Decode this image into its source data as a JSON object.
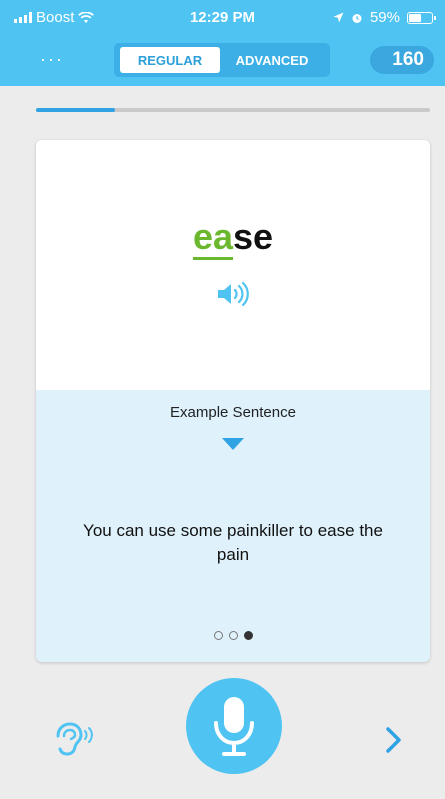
{
  "status_bar": {
    "carrier": "Boost",
    "time": "12:29 PM",
    "battery": "59%",
    "battery_level": 0.59
  },
  "header": {
    "menu": "···",
    "tabs": {
      "regular": "REGULAR",
      "advanced": "ADVANCED"
    },
    "selected_tab": "REGULAR",
    "score": "160"
  },
  "progress": {
    "fraction": 0.2
  },
  "card": {
    "word": {
      "highlight": "ea",
      "rest": "se"
    },
    "example_title": "Example Sentence",
    "sentence": "You can use some painkiller to ease the pain",
    "pages": 3,
    "current_page": 3
  },
  "controls": {
    "listen_icon": "ear-icon",
    "record_icon": "microphone-icon",
    "next_icon": "chevron-right-icon"
  },
  "colors": {
    "accent": "#4fc3f2",
    "highlight": "#6bb72e",
    "card_bottom": "#dff2fb"
  }
}
